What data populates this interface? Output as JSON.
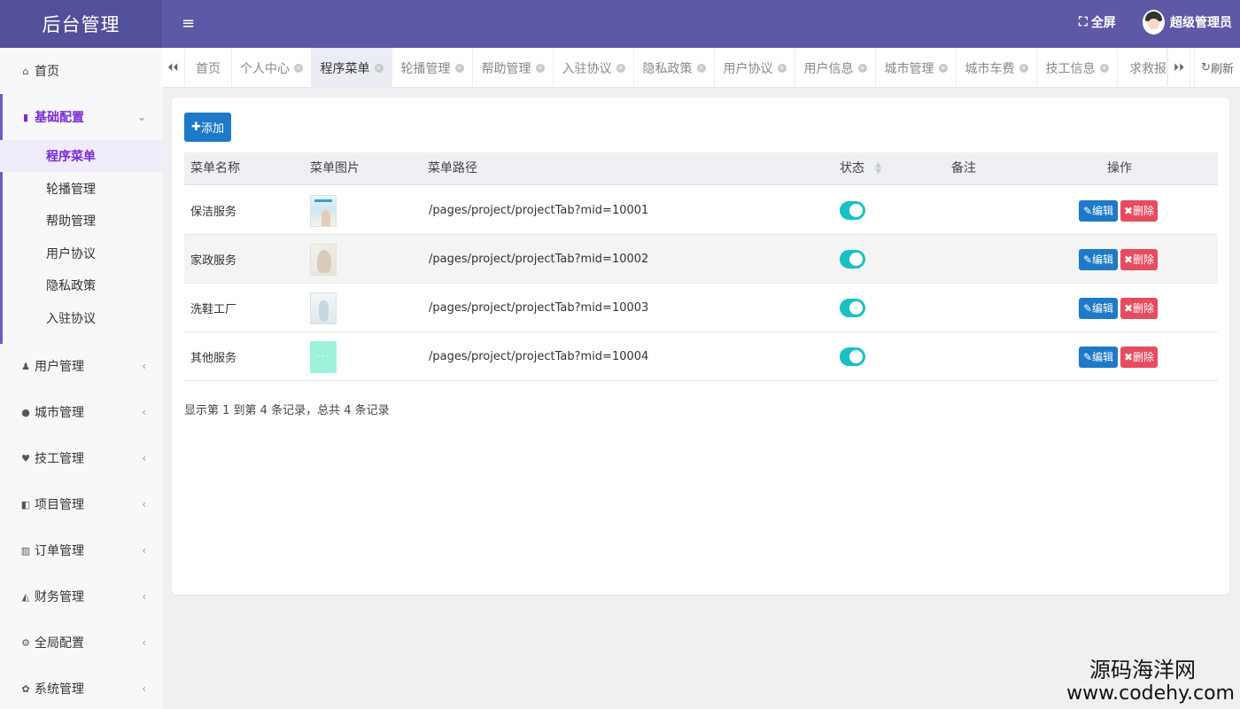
{
  "app": {
    "logo": "后台管理",
    "menu_icon": "≡",
    "fullscreen": "全屏",
    "fullscreen_icon": "⛶",
    "user_name": "超级管理员"
  },
  "sidebar": {
    "home": {
      "label": "首页",
      "icon": "⌂"
    },
    "config": {
      "label": "基础配置",
      "icon": "▮",
      "arrow": "⌄"
    },
    "sub_items": [
      "程序菜单",
      "轮播管理",
      "帮助管理",
      "用户协议",
      "隐私政策",
      "入驻协议"
    ],
    "groups": [
      {
        "label": "用户管理",
        "icon": "♟"
      },
      {
        "label": "城市管理",
        "icon": "●"
      },
      {
        "label": "技工管理",
        "icon": "♥"
      },
      {
        "label": "项目管理",
        "icon": "◧"
      },
      {
        "label": "订单管理",
        "icon": "▥"
      },
      {
        "label": "财务管理",
        "icon": "◭"
      },
      {
        "label": "全局配置",
        "icon": "⚙"
      },
      {
        "label": "系统管理",
        "icon": "✿"
      }
    ],
    "collapsed_arrow": "‹"
  },
  "tabs": {
    "prev_icon": "⏴⏴",
    "next_icon": "⏵⏵",
    "refresh": "刷新",
    "refresh_icon": "↻",
    "close_icon": "✕",
    "items": [
      "首页",
      "个人中心",
      "程序菜单",
      "轮播管理",
      "帮助管理",
      "入驻协议",
      "隐私政策",
      "用户协议",
      "用户信息",
      "城市管理",
      "城市车费",
      "技工信息",
      "求救报警"
    ]
  },
  "table": {
    "add_label": "添加",
    "add_icon": "✚",
    "columns": [
      "菜单名称",
      "菜单图片",
      "菜单路径",
      "状态",
      "备注",
      "操作"
    ],
    "edit_label": "编辑",
    "edit_icon": "✎",
    "delete_label": "删除",
    "delete_icon": "✖",
    "rows": [
      {
        "name": "保洁服务",
        "path": "/pages/project/projectTab?mid=10001",
        "status": true,
        "remark": ""
      },
      {
        "name": "家政服务",
        "path": "/pages/project/projectTab?mid=10002",
        "status": true,
        "remark": ""
      },
      {
        "name": "洗鞋工厂",
        "path": "/pages/project/projectTab?mid=10003",
        "status": true,
        "remark": ""
      },
      {
        "name": "其他服务",
        "path": "/pages/project/projectTab?mid=10004",
        "status": true,
        "remark": ""
      }
    ],
    "thumb_placeholder": "···",
    "footer": "显示第 1 到第 4 条记录，总共 4 条记录"
  },
  "watermark": {
    "line1": "源码海洋网",
    "line2": "www.codehy.com"
  },
  "colors": {
    "topbar": "#5d59a6",
    "accent": "#7a2bd6",
    "primary": "#1e7ac8",
    "danger": "#e64b60",
    "toggle": "#19c0c4"
  }
}
